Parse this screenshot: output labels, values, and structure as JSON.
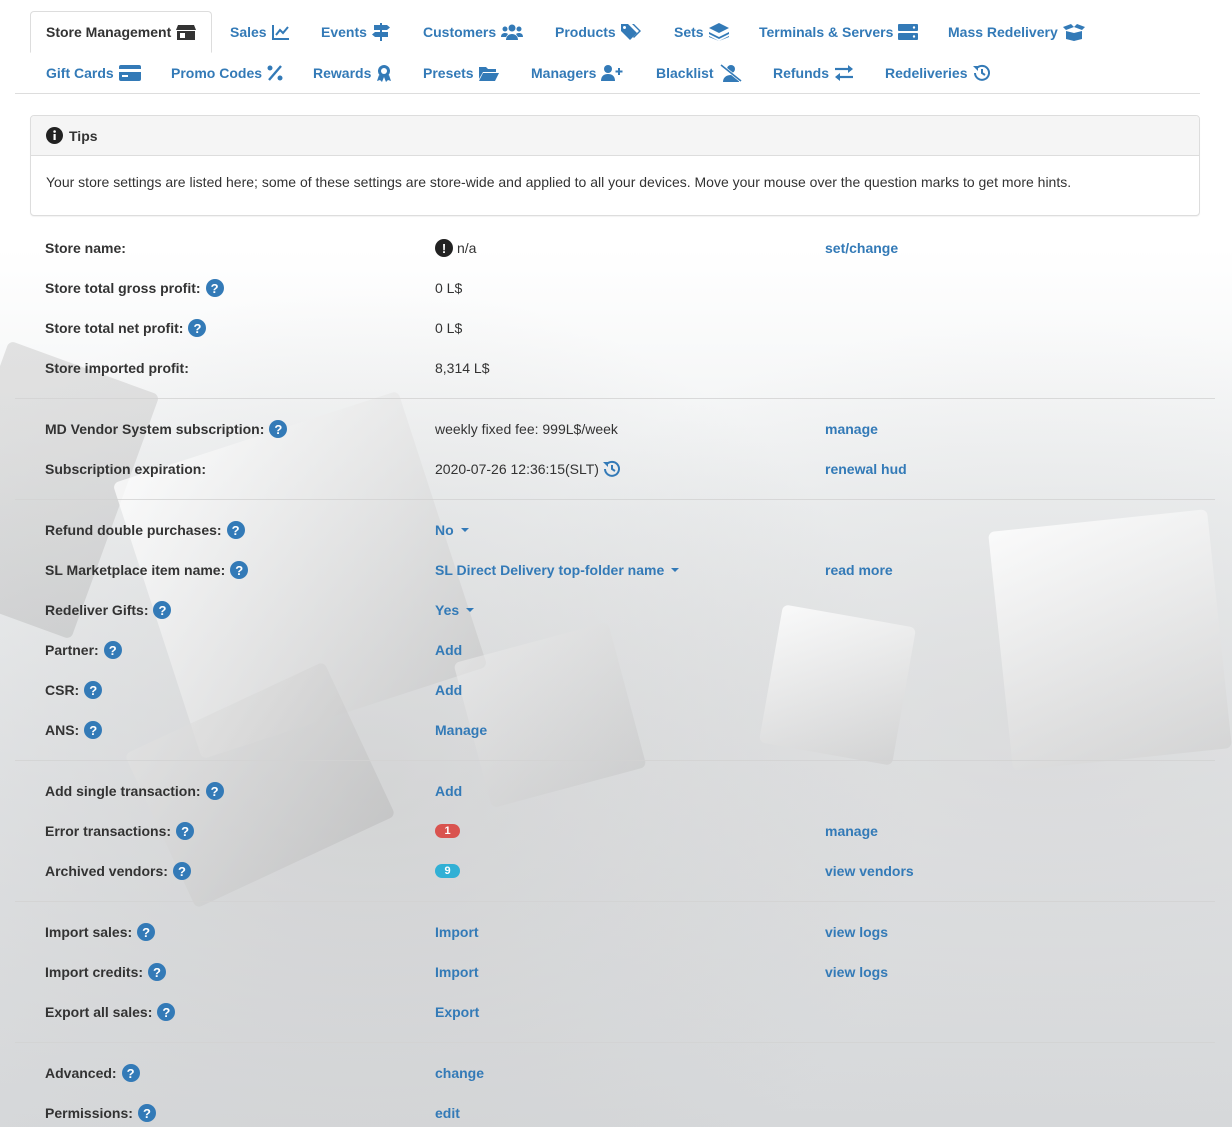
{
  "colors": {
    "link": "#337ab7",
    "badge_error": "#d9534f",
    "badge_info": "#31b0d5"
  },
  "tabs": [
    {
      "label": "Store Management",
      "icon": "store-icon",
      "active": true
    },
    {
      "label": "Sales",
      "icon": "chart-line-icon"
    },
    {
      "label": "Events",
      "icon": "signpost-icon"
    },
    {
      "label": "Customers",
      "icon": "users-icon"
    },
    {
      "label": "Products",
      "icon": "tags-icon"
    },
    {
      "label": "Sets",
      "icon": "layers-icon"
    },
    {
      "label": "Terminals & Servers",
      "icon": "server-icon"
    },
    {
      "label": "Mass Redelivery",
      "icon": "box-open-icon"
    },
    {
      "label": "Gift Cards",
      "icon": "credit-card-icon"
    },
    {
      "label": "Promo Codes",
      "icon": "percent-icon"
    },
    {
      "label": "Rewards",
      "icon": "award-icon"
    },
    {
      "label": "Presets",
      "icon": "folder-open-icon"
    },
    {
      "label": "Managers",
      "icon": "user-plus-icon"
    },
    {
      "label": "Blacklist",
      "icon": "user-slash-icon"
    },
    {
      "label": "Refunds",
      "icon": "exchange-icon"
    },
    {
      "label": "Redeliveries",
      "icon": "history-icon"
    }
  ],
  "tips": {
    "title": "Tips",
    "text": "Your store settings are listed here; some of these settings are store-wide and applied to all your devices. Move your mouse over the question marks to get more hints."
  },
  "rows": [
    {
      "label": "Store name:",
      "help": false,
      "value": "n/a",
      "action": "set/change"
    },
    {
      "label": "Store total gross profit:",
      "help": true,
      "value": "0 L$"
    },
    {
      "label": "Store total net profit:",
      "help": true,
      "value": "0 L$"
    },
    {
      "label": "Store imported profit:",
      "help": false,
      "value": "8,314 L$"
    },
    {
      "label": "MD Vendor System subscription:",
      "help": true,
      "value": "weekly fixed fee: 999L$/week",
      "action": "manage"
    },
    {
      "label": "Subscription expiration:",
      "help": false,
      "value": "2020-07-26 12:36:15(SLT)",
      "action": "renewal hud"
    },
    {
      "label": "Refund double purchases:",
      "help": true,
      "value": "No"
    },
    {
      "label": "SL Marketplace item name:",
      "help": true,
      "value": "SL Direct Delivery top-folder name",
      "action": "read more"
    },
    {
      "label": "Redeliver Gifts:",
      "help": true,
      "value": "Yes"
    },
    {
      "label": "Partner:",
      "help": true,
      "value": "Add"
    },
    {
      "label": "CSR:",
      "help": true,
      "value": "Add"
    },
    {
      "label": "ANS:",
      "help": true,
      "value": "Manage"
    },
    {
      "label": "Add single transaction:",
      "help": true,
      "value": "Add"
    },
    {
      "label": "Error transactions:",
      "help": true,
      "value": "1",
      "action": "manage"
    },
    {
      "label": "Archived vendors:",
      "help": true,
      "value": "9",
      "action": "view vendors"
    },
    {
      "label": "Import sales:",
      "help": true,
      "value": "Import",
      "action": "view logs"
    },
    {
      "label": "Import credits:",
      "help": true,
      "value": "Import",
      "action": "view logs"
    },
    {
      "label": "Export all sales:",
      "help": true,
      "value": "Export"
    },
    {
      "label": "Advanced:",
      "help": true,
      "value": "change"
    },
    {
      "label": "Permissions:",
      "help": true,
      "value": "edit"
    }
  ],
  "help_glyph": "?",
  "warn_glyph": "!"
}
